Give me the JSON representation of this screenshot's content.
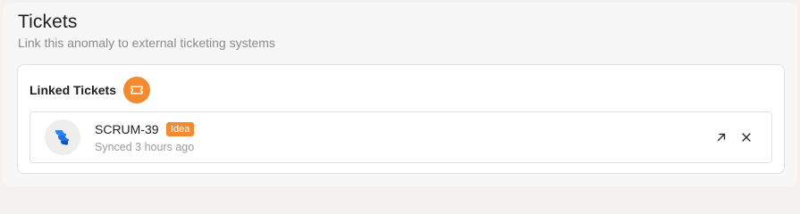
{
  "section": {
    "title": "Tickets",
    "subtitle": "Link this anomaly to external ticketing systems"
  },
  "linked_tickets": {
    "title": "Linked Tickets",
    "badge_icon": "ticket-icon",
    "accent_color": "#f28a2f",
    "items": [
      {
        "id": "SCRUM-39",
        "type": "Idea",
        "sync_status": "Synced 3 hours ago",
        "provider_icon": "jira-icon",
        "actions": {
          "open_icon": "arrow-up-right-icon",
          "remove_icon": "close-icon"
        }
      }
    ]
  }
}
